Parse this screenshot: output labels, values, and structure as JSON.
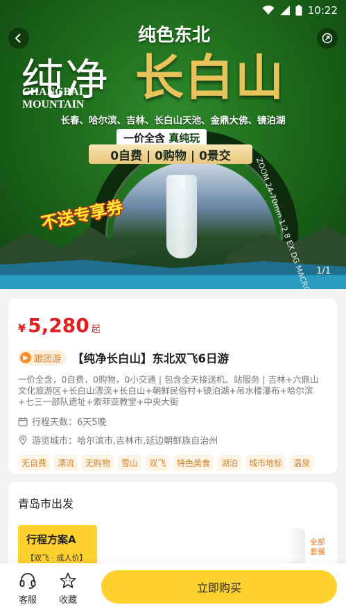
{
  "status_bar": {
    "time": "10:22"
  },
  "banner": {
    "brand_logo_text": "纯色东北",
    "title_primary": "纯净",
    "title_secondary": "长白山",
    "title_en_line1": "CHANGBAI",
    "title_en_line2": "MOUNTAIN",
    "cities": "长春、哈尔滨、吉林、长白山天池、金鼎大佛、镜泊湖",
    "slogan_prefix": "一价全含",
    "slogan_highlight": "真纯玩",
    "zero_items": "0自费 | 0购物 | 0景交",
    "lens_text": "ZOOM 24-70mm 1:2.8 EX DG MACRO",
    "coupon_tag": "不送专享券",
    "page_indicator": "1/1"
  },
  "product": {
    "currency": "¥",
    "price": "5,280",
    "price_suffix": "起",
    "badge": "跟团游",
    "title": "【纯净长白山】东北双飞6日游",
    "description": "一价全含，0自费，0购物，0小交通 | 包含全天接送机、站服务 | 吉林+六鼎山文化旅游区+长白山漂流+长白山+朝鲜民俗村+镜泊湖+吊水楼瀑布+哈尔滨+七三一部队遗址+索菲亚教堂+中央大街",
    "days_label": "行程天数：6天5晚",
    "cities_label": "游览城市：哈尔滨市,吉林市,延边朝鲜族自治州",
    "tags": [
      "无自费",
      "漂流",
      "无购物",
      "雪山",
      "双飞",
      "特色美食",
      "湖泊",
      "城市地标",
      "温泉"
    ]
  },
  "departure": {
    "title": "青岛市出发",
    "plan_name": "行程方案A",
    "plan_sub": "【双飞 · 成人价】",
    "all_packages": "全部套餐"
  },
  "bottom_bar": {
    "service_label": "客服",
    "favorite_label": "收藏",
    "buy_label": "立即购买"
  },
  "colors": {
    "accent_yellow": "#ffd12e",
    "price_red": "#e02020",
    "tag_orange": "#d9822b"
  }
}
